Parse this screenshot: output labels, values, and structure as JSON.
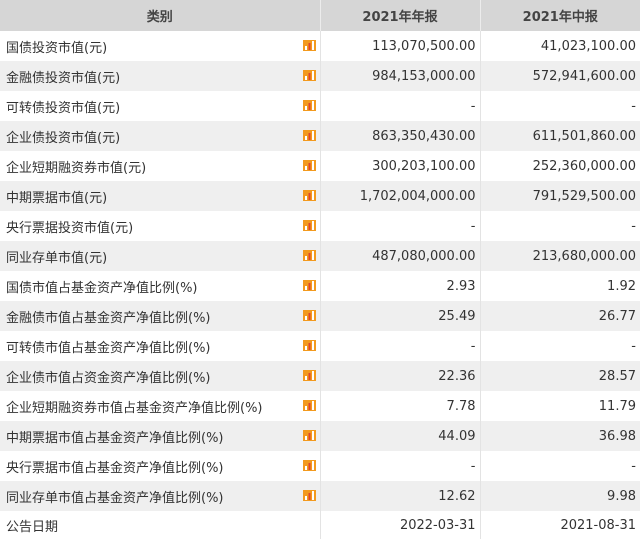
{
  "table": {
    "headers": [
      "类别",
      "2021年年报",
      "2021年中报"
    ],
    "rows": [
      {
        "label": "国债投资市值(元)",
        "v1": "113,070,500.00",
        "v2": "41,023,100.00",
        "icon": "bar-chart-icon"
      },
      {
        "label": "金融债投资市值(元)",
        "v1": "984,153,000.00",
        "v2": "572,941,600.00",
        "icon": "bar-chart-icon"
      },
      {
        "label": "可转债投资市值(元)",
        "v1": "-",
        "v2": "-",
        "icon": "bar-chart-icon"
      },
      {
        "label": "企业债投资市值(元)",
        "v1": "863,350,430.00",
        "v2": "611,501,860.00",
        "icon": "bar-chart-icon"
      },
      {
        "label": "企业短期融资券市值(元)",
        "v1": "300,203,100.00",
        "v2": "252,360,000.00",
        "icon": "bar-chart-icon"
      },
      {
        "label": "中期票据市值(元)",
        "v1": "1,702,004,000.00",
        "v2": "791,529,500.00",
        "icon": "bar-chart-icon"
      },
      {
        "label": "央行票据投资市值(元)",
        "v1": "-",
        "v2": "-",
        "icon": "bar-chart-icon"
      },
      {
        "label": "同业存单市值(元)",
        "v1": "487,080,000.00",
        "v2": "213,680,000.00",
        "icon": "bar-chart-icon"
      },
      {
        "label": "国债市值占基金资产净值比例(%)",
        "v1": "2.93",
        "v2": "1.92",
        "icon": "bar-chart-icon"
      },
      {
        "label": "金融债市值占基金资产净值比例(%)",
        "v1": "25.49",
        "v2": "26.77",
        "icon": "bar-chart-icon"
      },
      {
        "label": "可转债市值占基金资产净值比例(%)",
        "v1": "-",
        "v2": "-",
        "icon": "bar-chart-icon"
      },
      {
        "label": "企业债市值占资金资产净值比例(%)",
        "v1": "22.36",
        "v2": "28.57",
        "icon": "bar-chart-icon"
      },
      {
        "label": "企业短期融资券市值占基金资产净值比例(%)",
        "v1": "7.78",
        "v2": "11.79",
        "icon": "bar-chart-icon"
      },
      {
        "label": "中期票据市值占基金资产净值比例(%)",
        "v1": "44.09",
        "v2": "36.98",
        "icon": "bar-chart-icon"
      },
      {
        "label": "央行票据市值占基金资产净值比例(%)",
        "v1": "-",
        "v2": "-",
        "icon": "bar-chart-icon"
      },
      {
        "label": "同业存单市值占基金资产净值比例(%)",
        "v1": "12.62",
        "v2": "9.98",
        "icon": "bar-chart-icon"
      },
      {
        "label": "公告日期",
        "v1": "2022-03-31",
        "v2": "2021-08-31"
      }
    ]
  },
  "colors": {
    "header_bg": "#d6d6d6",
    "stripe_bg": "#efefef",
    "icon_orange": "#f39a1e",
    "icon_red": "#e0452c"
  }
}
